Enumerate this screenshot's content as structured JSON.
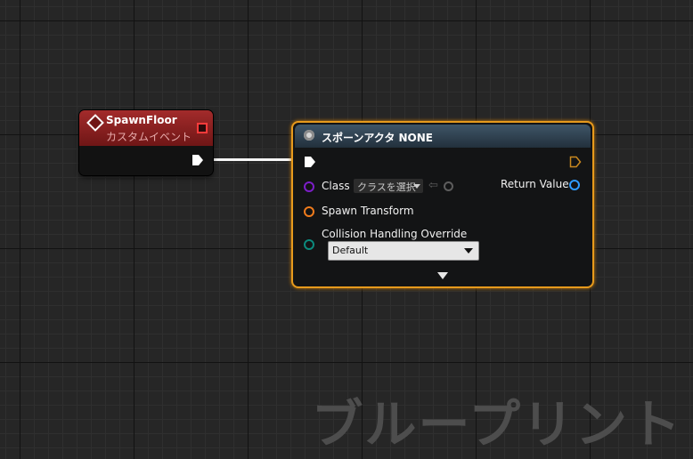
{
  "event_node": {
    "title": "SpawnFloor",
    "subtitle": "カスタムイベント",
    "header_color": "#9d2a2a"
  },
  "spawn_node": {
    "title": "スポーンアクタ NONE",
    "header_color": "#2f4354",
    "border_color": "#e79a1c",
    "pins": {
      "class_label": "Class",
      "class_value": "クラスを選択",
      "return_label": "Return Value",
      "transform_label": "Spawn Transform",
      "collision_label": "Collision Handling Override",
      "collision_value": "Default"
    },
    "pin_colors": {
      "class": "#7c1ec8",
      "return": "#2e9cff",
      "transform": "#f07b1c",
      "collision": "#0c8a7d"
    }
  },
  "watermark": "ブループリント",
  "icons": [
    "event-diamond-icon",
    "gear-icon",
    "exec-arrow-icon",
    "search-icon",
    "back-arrow-icon",
    "expand-arrow-icon"
  ]
}
